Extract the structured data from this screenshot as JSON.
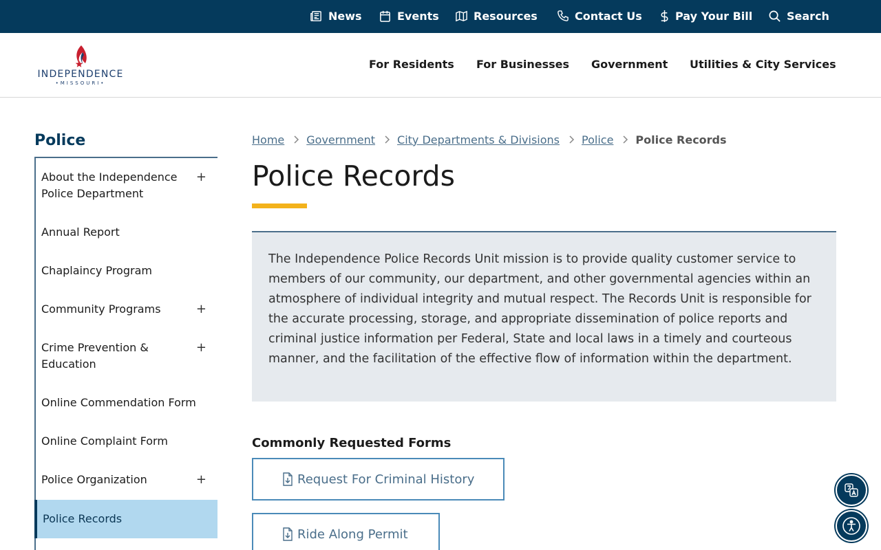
{
  "utility_nav": {
    "news": "News",
    "events": "Events",
    "resources": "Resources",
    "contact": "Contact Us",
    "pay_bill": "Pay Your Bill",
    "search": "Search"
  },
  "logo": {
    "name": "INDEPENDENCE",
    "state": "•MISSOURI•"
  },
  "main_nav": {
    "residents": "For Residents",
    "businesses": "For Businesses",
    "government": "Government",
    "utilities": "Utilities & City Services"
  },
  "sidebar": {
    "title": "Police",
    "items": [
      {
        "label": "About the Independence Police Department",
        "expandable": "+"
      },
      {
        "label": "Annual Report"
      },
      {
        "label": "Chaplaincy Program"
      },
      {
        "label": "Community Programs",
        "expandable": "+"
      },
      {
        "label": "Crime Prevention & Education",
        "expandable": "+"
      },
      {
        "label": "Online Commendation Form"
      },
      {
        "label": "Online Complaint Form"
      },
      {
        "label": "Police Organization",
        "expandable": "+"
      },
      {
        "label": "Police Records"
      }
    ]
  },
  "breadcrumb": {
    "home": "Home",
    "government": "Government",
    "departments": "City Departments & Divisions",
    "police": "Police",
    "current": "Police Records"
  },
  "page": {
    "title": "Police Records",
    "intro": "The Independence Police Records Unit mission is to provide quality customer service to members of our community, our department, and other governmental agencies within an atmosphere of individual integrity and mutual respect. The Records Unit is responsible for the accurate processing, storage, and appropriate dissemination of police reports and criminal justice information per Federal, State and local laws in a timely and courteous manner, and the facilitation of the effective flow of information within the department.",
    "forms_heading": "Commonly Requested Forms",
    "forms": [
      {
        "label": "Request For Criminal History"
      },
      {
        "label": "Ride Along Permit"
      }
    ]
  },
  "colors": {
    "navy": "#053a5c",
    "accent_gold": "#f3b21b",
    "link_blue": "#4a6e8a",
    "active_bg": "#b1d8ef",
    "intro_bg": "#e6eaee"
  }
}
